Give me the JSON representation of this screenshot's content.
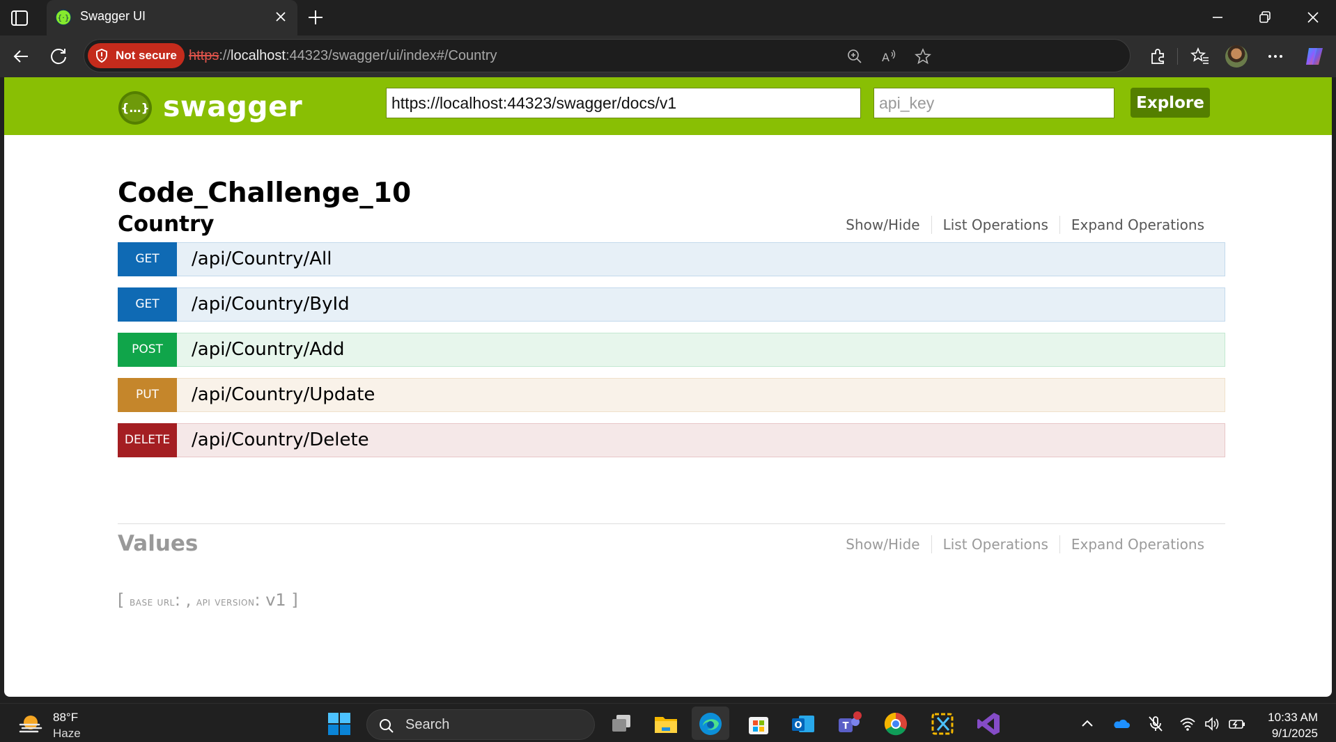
{
  "browser": {
    "tab_title": "Swagger UI",
    "security_label": "Not secure",
    "url_scheme": "https",
    "url_sep": "://",
    "url_host": "localhost",
    "url_rest": ":44323/swagger/ui/index#/Country"
  },
  "header": {
    "logo_text": "swagger",
    "spec_url": "https://localhost:44323/swagger/docs/v1",
    "api_key_placeholder": "api_key",
    "explore_label": "Explore"
  },
  "api_title": "Code_Challenge_10",
  "resources": [
    {
      "name": "Country",
      "links": [
        "Show/Hide",
        "List Operations",
        "Expand Operations"
      ],
      "operations": [
        {
          "method": "GET",
          "path": "/api/Country/All"
        },
        {
          "method": "GET",
          "path": "/api/Country/ById"
        },
        {
          "method": "POST",
          "path": "/api/Country/Add"
        },
        {
          "method": "PUT",
          "path": "/api/Country/Update"
        },
        {
          "method": "DELETE",
          "path": "/api/Country/Delete"
        }
      ]
    },
    {
      "name": "Values",
      "links": [
        "Show/Hide",
        "List Operations",
        "Expand Operations"
      ]
    }
  ],
  "footer": {
    "open_bracket": "[",
    "base_url_label": "base url",
    "colon_sep": ": ,",
    "api_version_label": "api version",
    "colon": ":",
    "api_version": "v1",
    "close_bracket": "]"
  },
  "taskbar": {
    "temperature": "88°F",
    "condition": "Haze",
    "search_label": "Search",
    "time": "10:33 AM",
    "date": "9/1/2025"
  },
  "colors": {
    "swagger_green": "#89bf04",
    "get": "#0f6ab4",
    "post": "#10a54a",
    "put": "#c5862b",
    "delete": "#a41e22"
  }
}
